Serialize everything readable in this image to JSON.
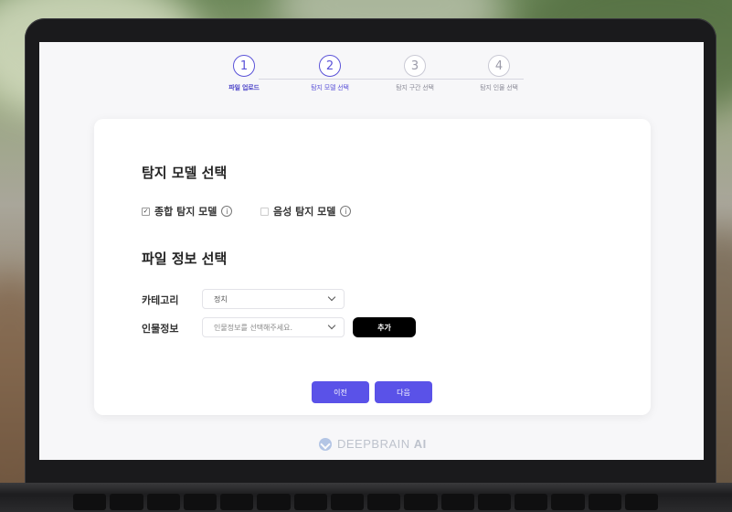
{
  "stepper": {
    "steps": [
      {
        "number": "1",
        "label": "파일 업로드"
      },
      {
        "number": "2",
        "label": "탐지 모델 선택"
      },
      {
        "number": "3",
        "label": "탐지 구간 선택"
      },
      {
        "number": "4",
        "label": "탐지 인물 선택"
      }
    ]
  },
  "model_section": {
    "title": "탐지 모델 선택",
    "options": [
      {
        "label": "종합 탐지 모델",
        "checked": true
      },
      {
        "label": "음성 탐지 모델",
        "checked": false
      }
    ]
  },
  "file_info": {
    "title": "파일 정보 선택",
    "category_label": "카테고리",
    "category_value": "정치",
    "person_label": "인물정보",
    "person_placeholder": "인물정보를 선택해주세요.",
    "add_label": "추가"
  },
  "nav": {
    "prev_label": "이전",
    "next_label": "다음"
  },
  "brand": {
    "name": "DEEPBRAIN",
    "suffix": "AI"
  },
  "colors": {
    "accent": "#5a52e8",
    "add_button": "#000000"
  }
}
